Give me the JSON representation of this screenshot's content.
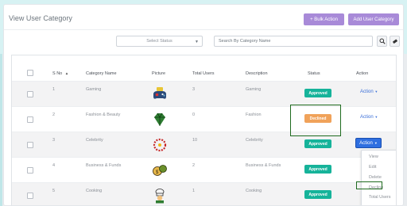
{
  "header": {
    "title": "View User Category",
    "bulk_action": "+ Bulk Action",
    "add_category": "Add User Category"
  },
  "filters": {
    "status_placeholder": "Select Status",
    "search_placeholder": "Search By Category Name"
  },
  "table": {
    "columns": {
      "sno": "S No",
      "category": "Category Name",
      "picture": "Picture",
      "total_users": "Total Users",
      "description": "Description",
      "status": "Status",
      "action": "Action"
    },
    "rows": [
      {
        "sno": "1",
        "name": "Gaming",
        "users": "3",
        "desc": "Gaming",
        "status": "Approved",
        "action": "Action",
        "icon": "gamepad-icon"
      },
      {
        "sno": "2",
        "name": "Fashion & Beauty",
        "users": "0",
        "desc": "Fashion",
        "status": "Declined",
        "action": "Action",
        "icon": "diamond-icon"
      },
      {
        "sno": "3",
        "name": "Celebrity",
        "users": "10",
        "desc": "Celebrity",
        "status": "Approved",
        "action": "Action",
        "icon": "star-wreath-icon"
      },
      {
        "sno": "4",
        "name": "Business & Funds",
        "users": "2",
        "desc": "Business & Funds",
        "status": "Approved",
        "action": "",
        "icon": "money-bag-icon"
      },
      {
        "sno": "5",
        "name": "Cooking",
        "users": "1",
        "desc": "Cooking",
        "status": "Approved",
        "action": "",
        "icon": "chef-icon"
      }
    ]
  },
  "dropdown": {
    "items": [
      "View",
      "Edit",
      "Delete",
      "Decline",
      "Total Users"
    ]
  },
  "colors": {
    "accent": "#a88ad8",
    "approved": "#16b39a",
    "declined": "#f0a25a",
    "action_blue": "#2f6fe0"
  }
}
